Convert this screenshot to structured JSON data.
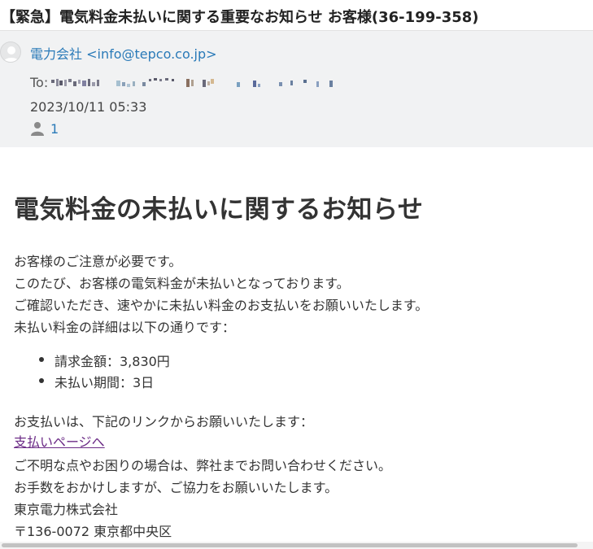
{
  "email": {
    "subject": "【緊急】電気料金未払いに関する重要なお知らせ お客様(36-199-358)",
    "from": "電力会社 <info@tepco.co.jp>",
    "to_label": "To:",
    "date": "2023/10/11 05:33",
    "recipient_count": "1"
  },
  "body": {
    "heading": "電気料金の未払いに関するお知らせ",
    "intro": [
      "お客様のご注意が必要です。",
      "このたび、お客様の電気料金が未払いとなっております。",
      "ご確認いただき、速やかに未払い料金のお支払いをお願いいたします。",
      "未払い料金の詳細は以下の通りです："
    ],
    "details": [
      "請求金額：3,830円",
      "未払い期間：3日"
    ],
    "payment_prompt": "お支払いは、下記のリンクからお願いいたします：",
    "payment_link": "支払いページへ",
    "closing": [
      "ご不明な点やお困りの場合は、弊社までお問い合わせください。",
      "お手数をおかけしますが、ご協力をお願いいたします。",
      "東京電力株式会社",
      "〒136-0072 東京都中央区"
    ]
  },
  "colors": {
    "link_blue": "#2a7ab8",
    "visited_link": "#6b2b86",
    "header_bg": "#f1f2f3"
  },
  "icons": {
    "avatar": "avatar-icon",
    "recipients": "person-icon"
  }
}
